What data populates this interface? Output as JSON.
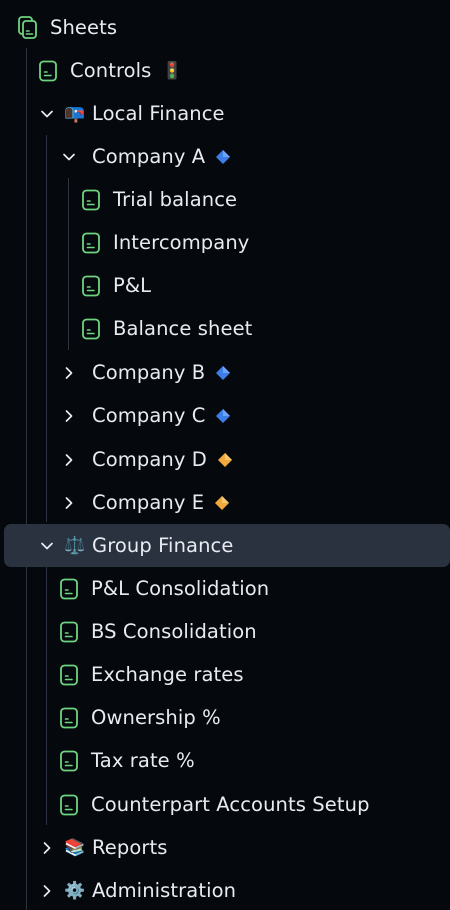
{
  "root": {
    "label": "Sheets",
    "icon": "sheets-icon"
  },
  "items": {
    "controls": {
      "label": "Controls",
      "emoji": "🚦"
    },
    "local_finance": {
      "label": "Local Finance",
      "emoji": "📭"
    },
    "company_a": {
      "label": "Company A",
      "badge_color": "#3d7fe6"
    },
    "trial_balance": {
      "label": "Trial balance"
    },
    "intercompany": {
      "label": "Intercompany"
    },
    "pl": {
      "label": "P&L"
    },
    "balance_sheet": {
      "label": "Balance sheet"
    },
    "company_b": {
      "label": "Company B",
      "badge_color": "#3d7fe6"
    },
    "company_c": {
      "label": "Company C",
      "badge_color": "#3d7fe6"
    },
    "company_d": {
      "label": "Company D",
      "badge_color": "#f0a93a"
    },
    "company_e": {
      "label": "Company E",
      "badge_color": "#f0a93a"
    },
    "group_finance": {
      "label": "Group Finance",
      "emoji": "⚖️"
    },
    "pl_consolidation": {
      "label": "P&L Consolidation"
    },
    "bs_consolidation": {
      "label": "BS Consolidation"
    },
    "exchange_rates": {
      "label": "Exchange rates"
    },
    "ownership": {
      "label": "Ownership %"
    },
    "tax_rate": {
      "label": "Tax rate %"
    },
    "counterpart_accounts": {
      "label": "Counterpart Accounts Setup"
    },
    "reports": {
      "label": "Reports",
      "emoji": "📚"
    },
    "administration": {
      "label": "Administration",
      "emoji": "⚙️"
    }
  },
  "colors": {
    "background": "#05080d",
    "text": "#e8ecf2",
    "sheet_icon": "#6ed47f",
    "selected_row": "#2a3240",
    "guide_line": "#2b3340"
  }
}
